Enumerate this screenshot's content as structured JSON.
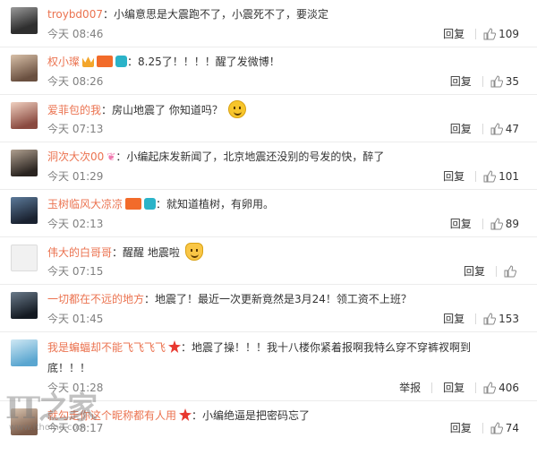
{
  "comments": [
    {
      "user": "troybd007",
      "text": "：小编意思是大震跑不了，小震死不了，要淡定",
      "time": "今天 08:46",
      "reply": "回复",
      "likes": "109"
    },
    {
      "user": "权小璨",
      "text": "：8.25了！！！！醒了发微博！",
      "time": "今天 08:26",
      "reply": "回复",
      "likes": "35"
    },
    {
      "user": "爱菲包的我",
      "text": "：房山地震了 你知道吗？",
      "time": "今天 07:13",
      "reply": "回复",
      "likes": "47"
    },
    {
      "user": "洞次大次00",
      "text": "：小编起床发新闻了，北京地震还没别的号发的快，醉了",
      "time": "今天 01:29",
      "reply": "回复",
      "likes": "101"
    },
    {
      "user": "玉树临风大凉凉",
      "text": "：就知道植树，有卵用。",
      "time": "今天 02:13",
      "reply": "回复",
      "likes": "89"
    },
    {
      "user": "伟大的白哥哥",
      "text": "：醒醒 地震啦",
      "time": "今天 07:15",
      "reply": "回复",
      "likes": ""
    },
    {
      "user": "一切都在不远的地方",
      "text": "：地震了！最近一次更新竟然是3月24！领工资不上班？",
      "time": "今天 01:45",
      "reply": "回复",
      "likes": "153"
    },
    {
      "user": "我是蝙蝠却不能飞飞飞飞",
      "text": "：地震了操！！！我十八楼你紧着报啊我特么穿不穿裤衩啊到底！！！",
      "time": "今天 01:28",
      "report": "举报",
      "reply": "回复",
      "likes": "406"
    },
    {
      "user": "就勾走你这个昵称都有人用",
      "text": "：小编绝逼是把密码忘了",
      "time": "今天 08:17",
      "reply": "回复",
      "likes": "74"
    }
  ],
  "avatar_colors": [
    "#3a3a3a",
    "#7a6a5a",
    "#c98a7a",
    "#4a4440",
    "#2c3d56",
    "#e6e6e6",
    "#2a3550",
    "#7fb9d9",
    "#a08070"
  ],
  "watermark": {
    "logo": "IT之家",
    "url": "www.ithome.com"
  }
}
